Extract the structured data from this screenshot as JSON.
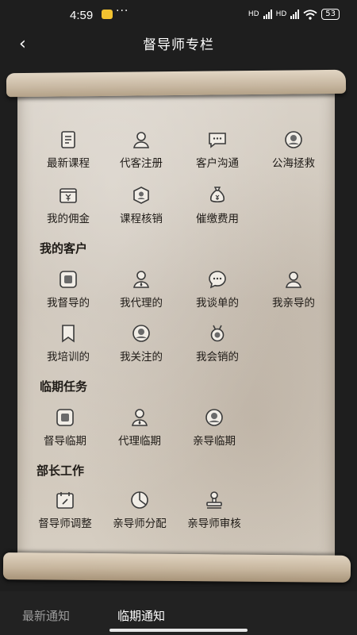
{
  "status_bar": {
    "time": "4:59",
    "dots": "···",
    "hd1": "HD",
    "hd2": "HD",
    "battery": "53"
  },
  "header": {
    "back_icon": "‹",
    "title": "督导师专栏"
  },
  "quick_menu": [
    {
      "label": "最新课程",
      "icon": "document-icon"
    },
    {
      "label": "代客注册",
      "icon": "user-icon"
    },
    {
      "label": "客户沟通",
      "icon": "message-icon"
    },
    {
      "label": "公海拯救",
      "icon": "ring-icon"
    },
    {
      "label": "我的佣金",
      "icon": "yen-card-icon"
    },
    {
      "label": "课程核销",
      "icon": "shield-icon"
    },
    {
      "label": "催缴费用",
      "icon": "money-bag-icon"
    }
  ],
  "my_clients": {
    "title": "我的客户",
    "items": [
      {
        "label": "我督导的",
        "icon": "square-icon"
      },
      {
        "label": "我代理的",
        "icon": "agent-icon"
      },
      {
        "label": "我谈单的",
        "icon": "chat-icon"
      },
      {
        "label": "我亲导的",
        "icon": "person-icon"
      },
      {
        "label": "我培训的",
        "icon": "bookmark-icon"
      },
      {
        "label": "我关注的",
        "icon": "face-icon"
      },
      {
        "label": "我会销的",
        "icon": "medal-icon"
      }
    ]
  },
  "expiring_tasks": {
    "title": "临期任务",
    "items": [
      {
        "label": "督导临期",
        "icon": "square-icon"
      },
      {
        "label": "代理临期",
        "icon": "agent-icon"
      },
      {
        "label": "亲导临期",
        "icon": "face-icon"
      }
    ]
  },
  "minister_work": {
    "title": "部长工作",
    "items": [
      {
        "label": "督导师调整",
        "icon": "calendar-icon"
      },
      {
        "label": "亲导师分配",
        "icon": "pie-icon"
      },
      {
        "label": "亲导师审核",
        "icon": "stamp-icon"
      }
    ]
  },
  "bottom_tabs": {
    "latest": "最新通知",
    "expiring": "临期通知"
  },
  "colors": {
    "background": "#1e1e1e",
    "parchment": "#d3cbbf",
    "active_tab": "#ffffff",
    "inactive_tab": "#9c9c9c"
  }
}
